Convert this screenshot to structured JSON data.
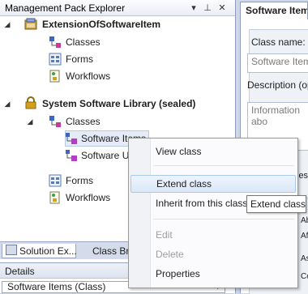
{
  "explorer": {
    "title": "Management Pack Explorer",
    "buttons": {
      "dropdown": "▾",
      "pin": "⊥",
      "close": "✕"
    },
    "pack1": {
      "name": "ExtensionOfSoftwareItem",
      "children": {
        "classes": "Classes",
        "forms": "Forms",
        "workflows": "Workflows"
      }
    },
    "pack2": {
      "name": "System Software Library (sealed)",
      "children": {
        "classes": "Classes",
        "class_items": [
          "Software Items",
          "Software U"
        ],
        "forms": "Forms",
        "workflows": "Workflows"
      }
    },
    "bottom_tabs": [
      "Solution Ex...",
      "Class Bro"
    ],
    "details": {
      "title": "Details",
      "selected": "Software Items (Class)"
    }
  },
  "document": {
    "tab_title": "Software Item",
    "class_name_label": "Class name:",
    "class_name_value": "Software Items",
    "description_label": "Description (opt",
    "description_value": "Information abo",
    "side_labels": [
      "ies",
      "Abo",
      "Affe",
      "Ass",
      "Co"
    ]
  },
  "context_menu": {
    "items": [
      {
        "label": "View class",
        "enabled": true
      },
      {
        "label": "Extend class",
        "enabled": true,
        "highlighted": true
      },
      {
        "label": "Inherit from this class",
        "enabled": true
      },
      {
        "label": "Edit",
        "enabled": false
      },
      {
        "label": "Delete",
        "enabled": false
      },
      {
        "label": "Properties",
        "enabled": true
      }
    ]
  },
  "tooltip": "Extend class",
  "colors": {
    "accent": "#a8c8ee",
    "chrome": "#cfd6e5",
    "lock": "#d4a017"
  }
}
